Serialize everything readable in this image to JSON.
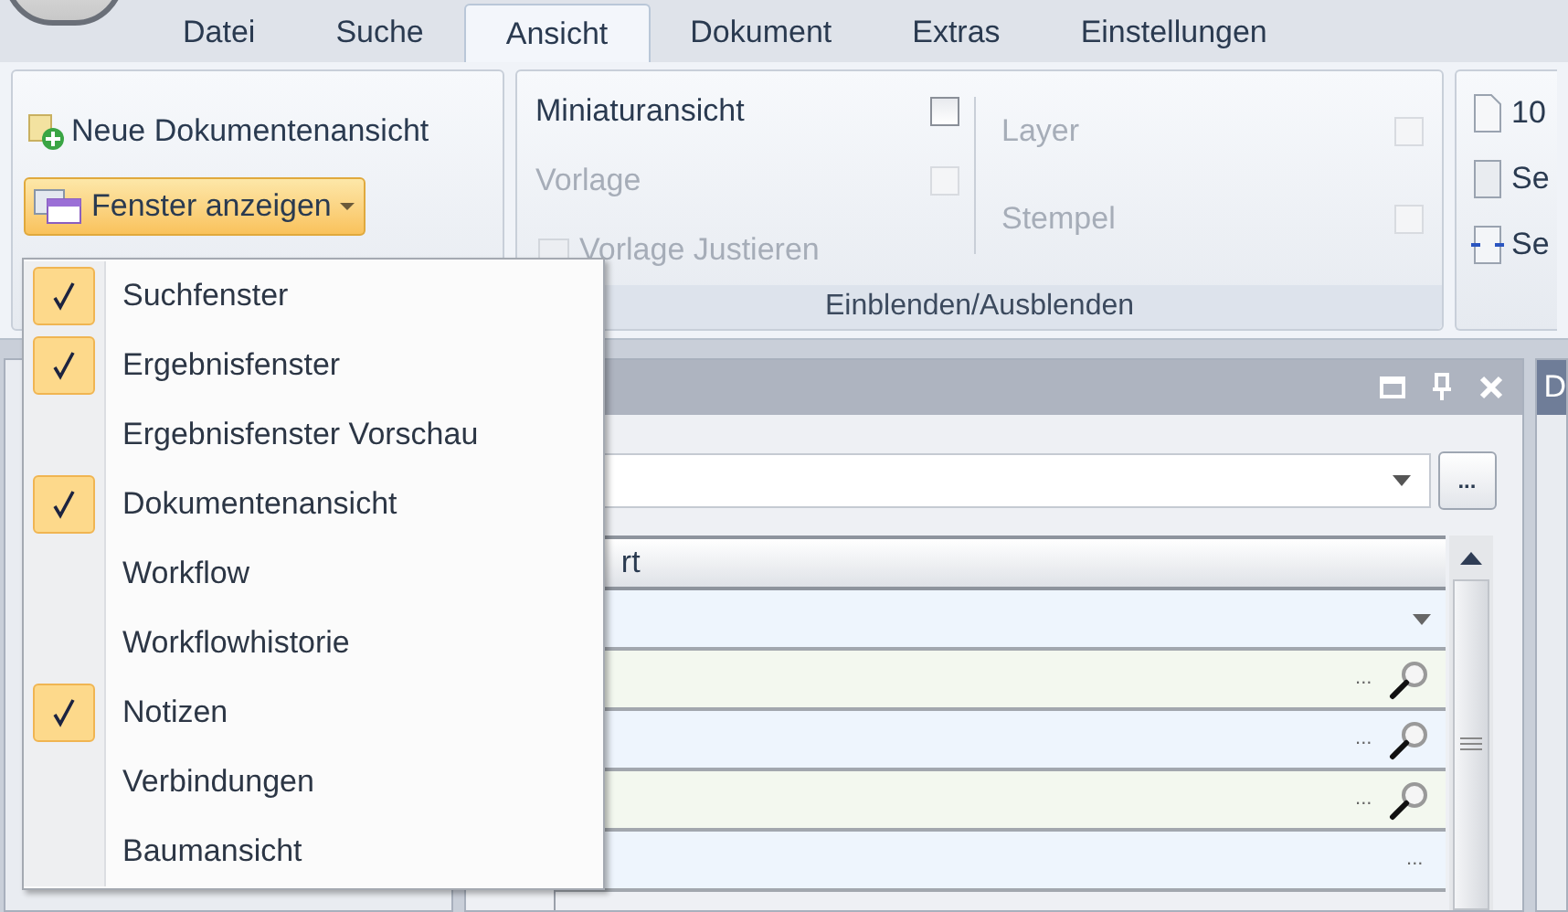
{
  "app_tabs": [
    {
      "label": "Datei",
      "selected": false
    },
    {
      "label": "Suche",
      "selected": false
    },
    {
      "label": "Ansicht",
      "selected": true
    },
    {
      "label": "Dokument",
      "selected": false
    },
    {
      "label": "Extras",
      "selected": false
    },
    {
      "label": "Einstellungen",
      "selected": false
    }
  ],
  "view_group": {
    "new_view": "Neue Dokumentenansicht",
    "show_windows": {
      "label": "Fenster anzeigen",
      "expanded": true
    }
  },
  "show_hide_group": {
    "title": "Einblenden/Ausblenden",
    "left": [
      {
        "kind": "checkbox",
        "label": "Miniaturansicht",
        "checked": false,
        "disabled": false
      },
      {
        "kind": "checkbox",
        "label": "Vorlage",
        "checked": false,
        "disabled": true
      },
      {
        "kind": "button",
        "label": "Vorlage Justieren",
        "disabled": true
      }
    ],
    "right": [
      {
        "kind": "checkbox",
        "label": "Layer",
        "checked": false,
        "disabled": true
      },
      {
        "kind": "checkbox",
        "label": "Stempel",
        "checked": false,
        "disabled": true
      }
    ]
  },
  "page_group": {
    "items": [
      {
        "kind": "zoom",
        "label": "10"
      },
      {
        "kind": "page",
        "label": "Se"
      },
      {
        "kind": "fit",
        "label": "Se"
      }
    ]
  },
  "window_menu": {
    "items": [
      {
        "label": "Suchfenster",
        "checked": true
      },
      {
        "label": "Ergebnisfenster",
        "checked": true
      },
      {
        "label": "Ergebnisfenster Vorschau",
        "checked": false
      },
      {
        "label": "Dokumentenansicht",
        "checked": true
      },
      {
        "label": "Workflow",
        "checked": false
      },
      {
        "label": "Workflowhistorie",
        "checked": false
      },
      {
        "label": "Notizen",
        "checked": true
      },
      {
        "label": "Verbindungen",
        "checked": false
      },
      {
        "label": "Baumansicht",
        "checked": false
      }
    ]
  },
  "search_panel": {
    "browse_button": "...",
    "grid_header": "rt",
    "rows": [
      {
        "kind": "dropdown"
      },
      {
        "kind": "lookup",
        "ellipsis": "..."
      },
      {
        "kind": "lookup",
        "ellipsis": "..."
      },
      {
        "kind": "lookup",
        "ellipsis": "..."
      },
      {
        "kind": "text",
        "ellipsis": "..."
      }
    ]
  },
  "right_panel": {
    "title": "D"
  }
}
